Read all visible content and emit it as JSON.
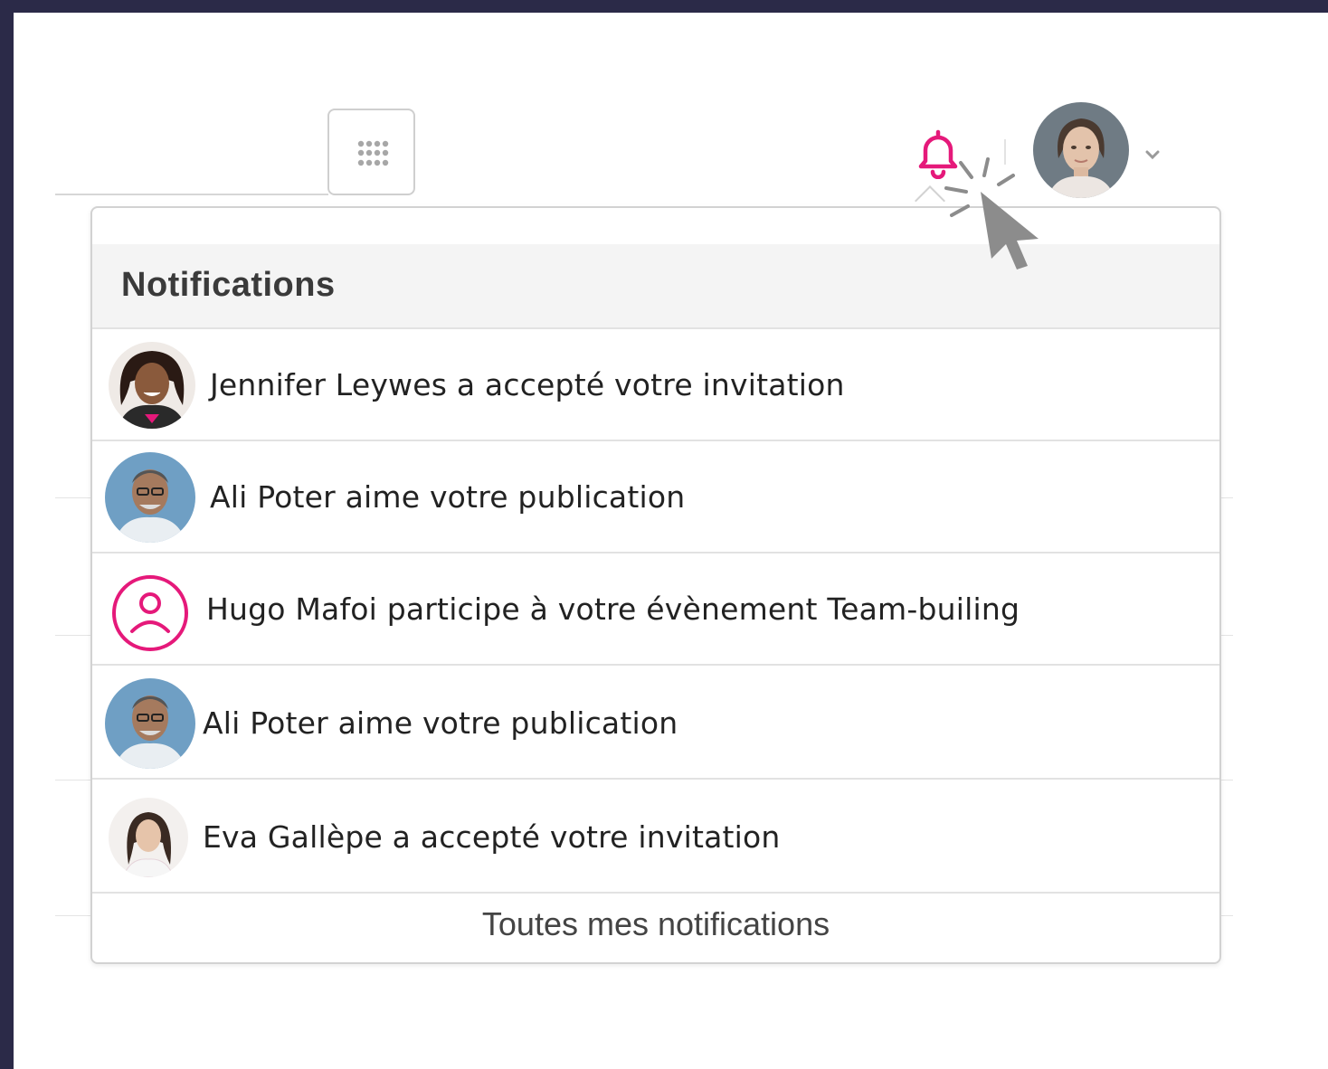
{
  "header": {
    "apps_icon": "grid-dots-icon",
    "bell_icon": "bell-icon",
    "profile_chevron_icon": "chevron-down-icon"
  },
  "notifications_panel": {
    "title": "Notifications",
    "items": [
      {
        "avatar": "photo-avatar",
        "text": "Jennifer Leywes a accepté votre invitation"
      },
      {
        "avatar": "photo-avatar",
        "text": "Ali Poter aime votre publication"
      },
      {
        "avatar": "user-placeholder-icon",
        "text": "Hugo Mafoi participe à votre évènement Team-builing"
      },
      {
        "avatar": "photo-avatar",
        "text": "Ali Poter aime votre publication"
      },
      {
        "avatar": "photo-avatar",
        "text": "Eva Gallèpe a accepté votre invitation"
      }
    ],
    "footer_link": "Toutes mes notifications"
  },
  "colors": {
    "accent": "#e5197a",
    "frame": "#2b2a48",
    "cursor": "#8c8c8c"
  }
}
